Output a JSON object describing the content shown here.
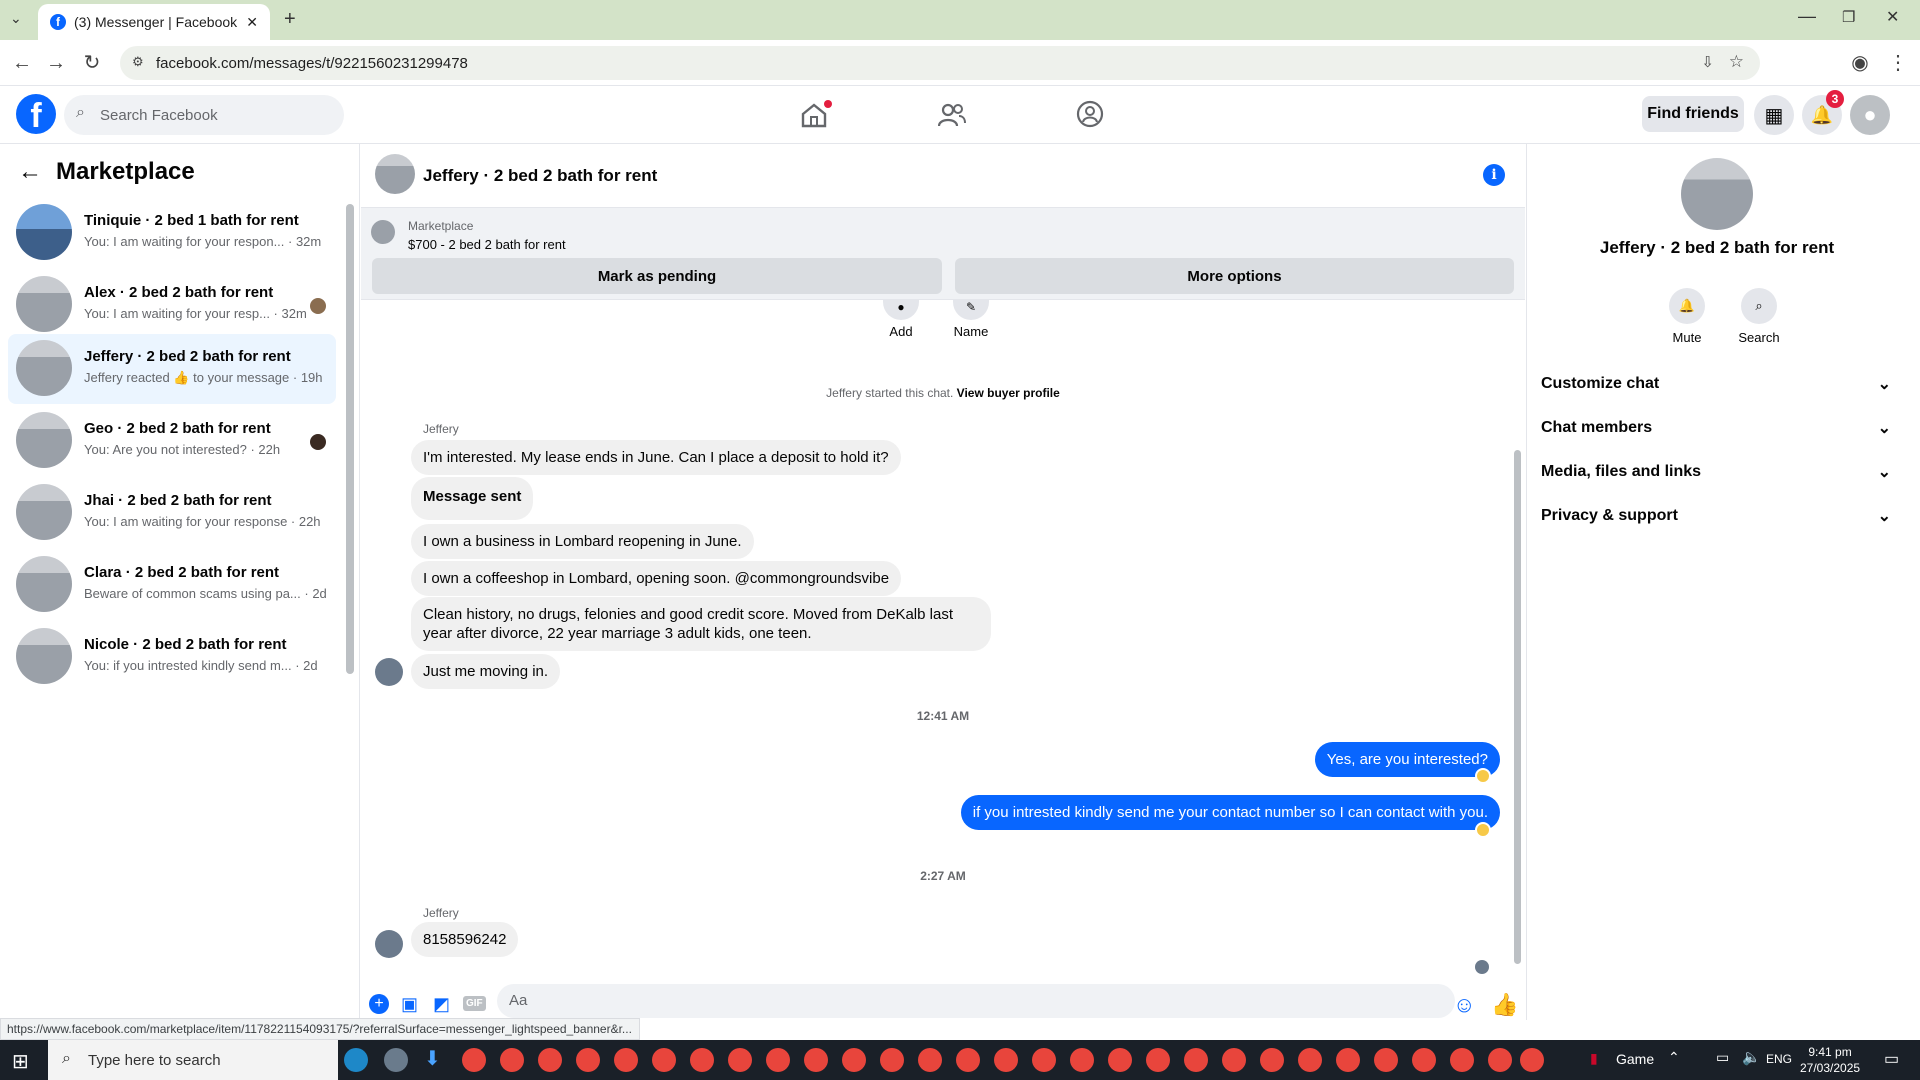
{
  "browser": {
    "tab_title": "(3) Messenger | Facebook",
    "url": "facebook.com/messages/t/9221560231299478",
    "status_url": "https://www.facebook.com/marketplace/item/1178221154093175/?referralSurface=messenger_lightspeed_banner&r..."
  },
  "header": {
    "search_placeholder": "Search Facebook",
    "find_friends": "Find friends",
    "notification_count": "3"
  },
  "left": {
    "title": "Marketplace",
    "conversations": [
      {
        "title": "Tiniquie · 2 bed 1 bath for rent",
        "preview": "You: I am waiting for your respon... · 32m"
      },
      {
        "title": "Alex · 2 bed 2 bath for rent",
        "preview": "You: I am waiting for your resp... · 32m"
      },
      {
        "title": "Jeffery · 2 bed 2 bath for rent",
        "preview": "Jeffery reacted 👍 to your message · 19h"
      },
      {
        "title": "Geo · 2 bed 2 bath for rent",
        "preview": "You: Are you not interested? · 22h"
      },
      {
        "title": "Jhai · 2 bed 2 bath for rent",
        "preview": "You: I am waiting for your response · 22h"
      },
      {
        "title": "Clara · 2 bed 2 bath for rent",
        "preview": "Beware of common scams using pa... · 2d"
      },
      {
        "title": "Nicole · 2 bed 2 bath for rent",
        "preview": "You: if you intrested kindly send m... · 2d"
      }
    ]
  },
  "chat": {
    "title": "Jeffery · 2 bed 2 bath for rent",
    "marketplace_label": "Marketplace",
    "listing": "$700 - 2 bed 2 bath for rent",
    "mark_pending": "Mark as pending",
    "more_options": "More options",
    "add_label": "Add",
    "name_label": "Name",
    "started": "Jeffery started this chat.",
    "view_profile": "View buyer profile",
    "sender": "Jeffery",
    "incoming": [
      "I'm interested. My lease ends in June. Can I place a deposit to hold it?",
      "Message sent",
      "I own a business in Lombard reopening in June.",
      "I own a coffeeshop in Lombard, opening soon. @commongroundsvibe",
      "Clean history, no drugs, felonies and good credit score. Moved from DeKalb last year after divorce, 22 year marriage 3 adult kids, one teen.",
      "Just me moving in."
    ],
    "time1": "12:41 AM",
    "outgoing": [
      "Yes, are you interested?",
      "if you intrested kindly send me your contact number so I can contact with you."
    ],
    "time2": "2:27 AM",
    "last_incoming": "8158596242",
    "composer_placeholder": "Aa"
  },
  "right": {
    "title": "Jeffery · 2 bed 2 bath for rent",
    "mute": "Mute",
    "search": "Search",
    "sections": [
      "Customize chat",
      "Chat members",
      "Media, files and links",
      "Privacy & support"
    ]
  },
  "taskbar": {
    "search_placeholder": "Type here to search",
    "game": "Game",
    "lang": "ENG",
    "time": "9:41 pm",
    "date": "27/03/2025"
  },
  "colors": {
    "accent": "#0866ff",
    "active_row": "#ebf5ff",
    "bubble_in": "#f0f0f0"
  }
}
